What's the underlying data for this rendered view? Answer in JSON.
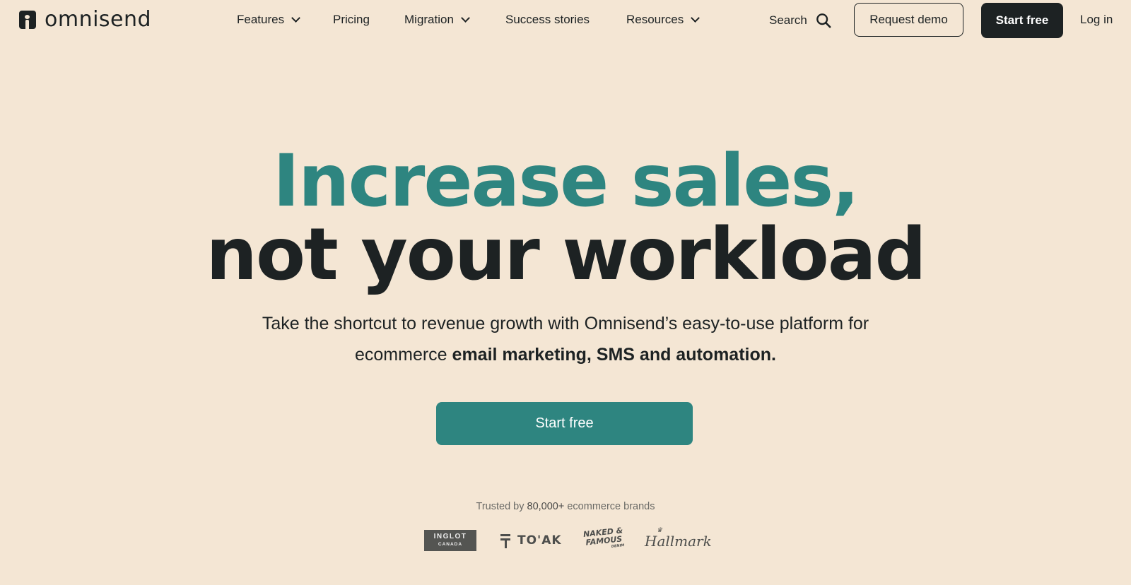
{
  "header": {
    "logo_text": "omnisend",
    "nav": [
      {
        "label": "Features",
        "has_dropdown": true
      },
      {
        "label": "Pricing",
        "has_dropdown": false
      },
      {
        "label": "Migration",
        "has_dropdown": true
      },
      {
        "label": "Success stories",
        "has_dropdown": false
      },
      {
        "label": "Resources",
        "has_dropdown": true
      }
    ],
    "search_label": "Search",
    "search_icon": "search-icon",
    "request_demo_label": "Request demo",
    "start_free_label": "Start free",
    "login_label": "Log in"
  },
  "hero": {
    "headline_line1": "Increase sales,",
    "headline_line2": "not your workload",
    "subheadline_part1": "Take the shortcut to revenue growth with Omnisend’s easy-to-use platform for",
    "subheadline_part2": "ecommerce ",
    "subheadline_bold": "email marketing, SMS and automation.",
    "cta_label": "Start free"
  },
  "trust": {
    "prefix": "Trusted by ",
    "count": "80,000+",
    "suffix": " ecommerce brands",
    "brands": [
      {
        "name": "INGLOT",
        "sub": "CANADA"
      },
      {
        "name": "TO'AK"
      },
      {
        "name": "NAKED &",
        "name2": "FAMOUS",
        "sub": "DENIM"
      },
      {
        "name": "Hallmark"
      }
    ]
  },
  "colors": {
    "background": "#f4e6d4",
    "accent": "#2e8580",
    "dark": "#1d2223"
  }
}
